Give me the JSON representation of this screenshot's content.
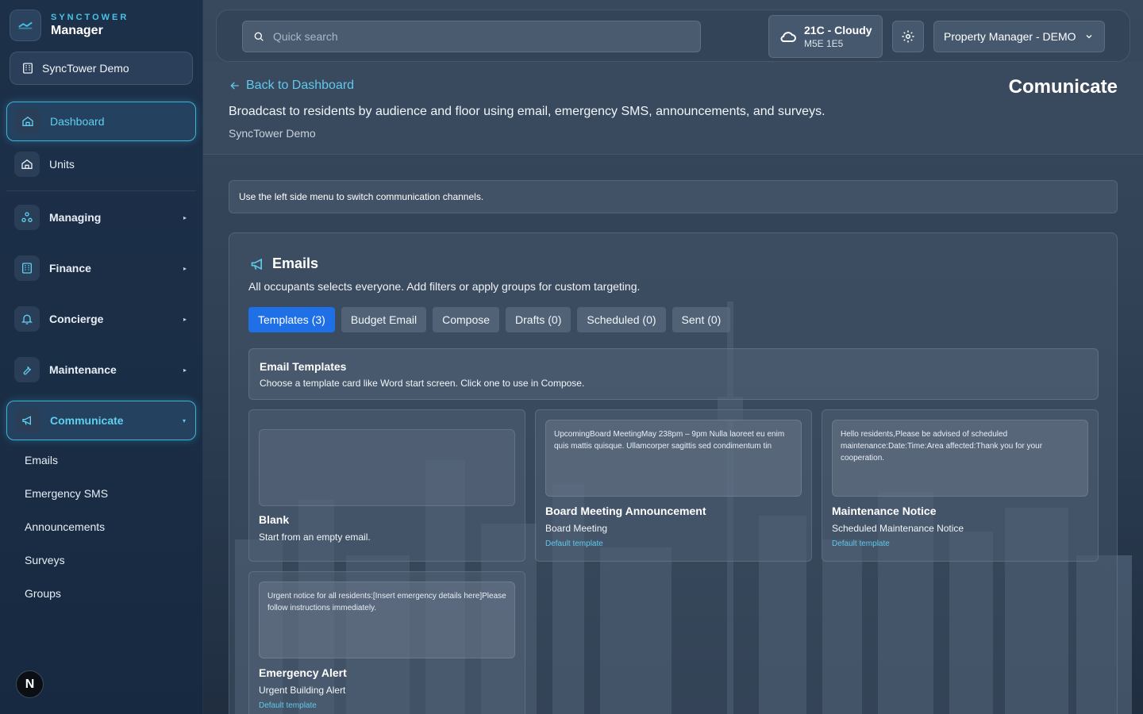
{
  "brand": {
    "top": "SYNCTOWER",
    "sub": "Manager"
  },
  "org_switch": {
    "label": "SyncTower Demo"
  },
  "sidebar": {
    "items": [
      {
        "label": "Dashboard"
      },
      {
        "label": "Units"
      },
      {
        "label": "Managing"
      },
      {
        "label": "Finance"
      },
      {
        "label": "Concierge"
      },
      {
        "label": "Maintenance"
      },
      {
        "label": "Communicate"
      }
    ],
    "sub_items": [
      "Emails",
      "Emergency SMS",
      "Announcements",
      "Surveys",
      "Groups"
    ],
    "badge": "N"
  },
  "topbar": {
    "search_placeholder": "Quick search",
    "weather_temp": "21C - Cloudy",
    "weather_code": "M5E 1E5",
    "role": "Property Manager - DEMO"
  },
  "header": {
    "back": "Back to Dashboard",
    "title": "Comunicate",
    "desc": "Broadcast to residents by audience and floor using email, emergency SMS, announcements, and surveys.",
    "org": "SyncTower Demo"
  },
  "notice": "Use the left side menu to switch communication channels.",
  "panel": {
    "title": "Emails",
    "desc": "All occupants selects everyone. Add filters or apply groups for custom targeting.",
    "tabs": [
      "Templates (3)",
      "Budget Email",
      "Compose",
      "Drafts (0)",
      "Scheduled (0)",
      "Sent (0)"
    ],
    "templates_title": "Email Templates",
    "templates_desc": "Choose a template card like Word start screen. Click one to use in Compose.",
    "cards": [
      {
        "preview": "",
        "title": "Blank",
        "sub": "Start from an empty email.",
        "tag": ""
      },
      {
        "preview": "UpcomingBoard MeetingMay 238pm – 9pm Nulla laoreet eu enim quis mattis quisque. Ullamcorper sagittis sed condimentum tin",
        "title": "Board Meeting Announcement",
        "sub": "Board Meeting",
        "tag": "Default template"
      },
      {
        "preview": "Hello residents,Please be advised of scheduled maintenance:Date:Time:Area affected:Thank you for your cooperation.",
        "title": "Maintenance Notice",
        "sub": "Scheduled Maintenance Notice",
        "tag": "Default template"
      },
      {
        "preview": "Urgent notice for all residents:[Insert emergency details here]Please follow instructions immediately.",
        "title": "Emergency Alert",
        "sub": "Urgent Building Alert",
        "tag": "Default template"
      }
    ]
  },
  "colors": {
    "accent": "#5fc8ec",
    "tab_active": "#1f6fe6",
    "sidebar_bg": "#1d3049"
  }
}
